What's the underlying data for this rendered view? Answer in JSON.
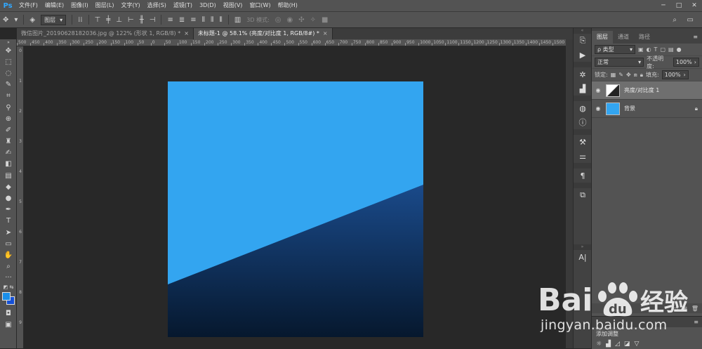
{
  "app": {
    "logo": "Ps"
  },
  "menu": [
    "文件(F)",
    "编辑(E)",
    "图像(I)",
    "图层(L)",
    "文字(Y)",
    "选择(S)",
    "滤镜(T)",
    "3D(D)",
    "视图(V)",
    "窗口(W)",
    "帮助(H)"
  ],
  "window_controls": [
    "─",
    "□",
    "✕"
  ],
  "options_bar": {
    "auto_select_value": "图层",
    "mode_3d_label": "3D 模式:"
  },
  "tabs": [
    {
      "label": "微信图片_20190628182036.jpg @ 122% (形状 1, RGB/8) *",
      "close": "×",
      "active": false
    },
    {
      "label": "未标题-1 @ 58.1% (亮度/对比度 1, RGB/8#) *",
      "close": "×",
      "active": true
    }
  ],
  "ruler": {
    "top_ticks": [
      "500",
      "450",
      "400",
      "350",
      "300",
      "250",
      "200",
      "150",
      "100",
      "50",
      "0",
      "50",
      "100",
      "150",
      "200",
      "250",
      "300",
      "350",
      "400",
      "450",
      "500",
      "550",
      "600",
      "650",
      "700",
      "750",
      "800",
      "850",
      "900",
      "950",
      "1000",
      "1050",
      "1100",
      "1150",
      "1200",
      "1250",
      "1300",
      "1350",
      "1400",
      "1450",
      "1500"
    ],
    "left_ticks": [
      "0",
      "1",
      "2",
      "3",
      "4",
      "5",
      "6",
      "7",
      "8",
      "9"
    ]
  },
  "canvas": {
    "top_color": "#33a5f0",
    "gradient_start": "#1a4a8a",
    "gradient_end": "#06182e"
  },
  "layers_panel": {
    "tabs": [
      "图层",
      "通道",
      "路径"
    ],
    "filter_kind": "ρ 类型",
    "blend_mode": "正常",
    "opacity_label": "不透明度:",
    "opacity_value": "100%",
    "lock_label": "锁定:",
    "fill_label": "填充:",
    "fill_value": "100%",
    "layers": [
      {
        "name": "亮度/对比度 1",
        "selected": true
      },
      {
        "name": "背景",
        "selected": false
      }
    ]
  },
  "adjustments_panel": {
    "label": "添加调整"
  },
  "watermark": {
    "text": "Bai 经验",
    "url": "jingyan.baidu.com"
  },
  "colors": {
    "fg": "#1a8fe8",
    "bg": "#1550d6"
  }
}
